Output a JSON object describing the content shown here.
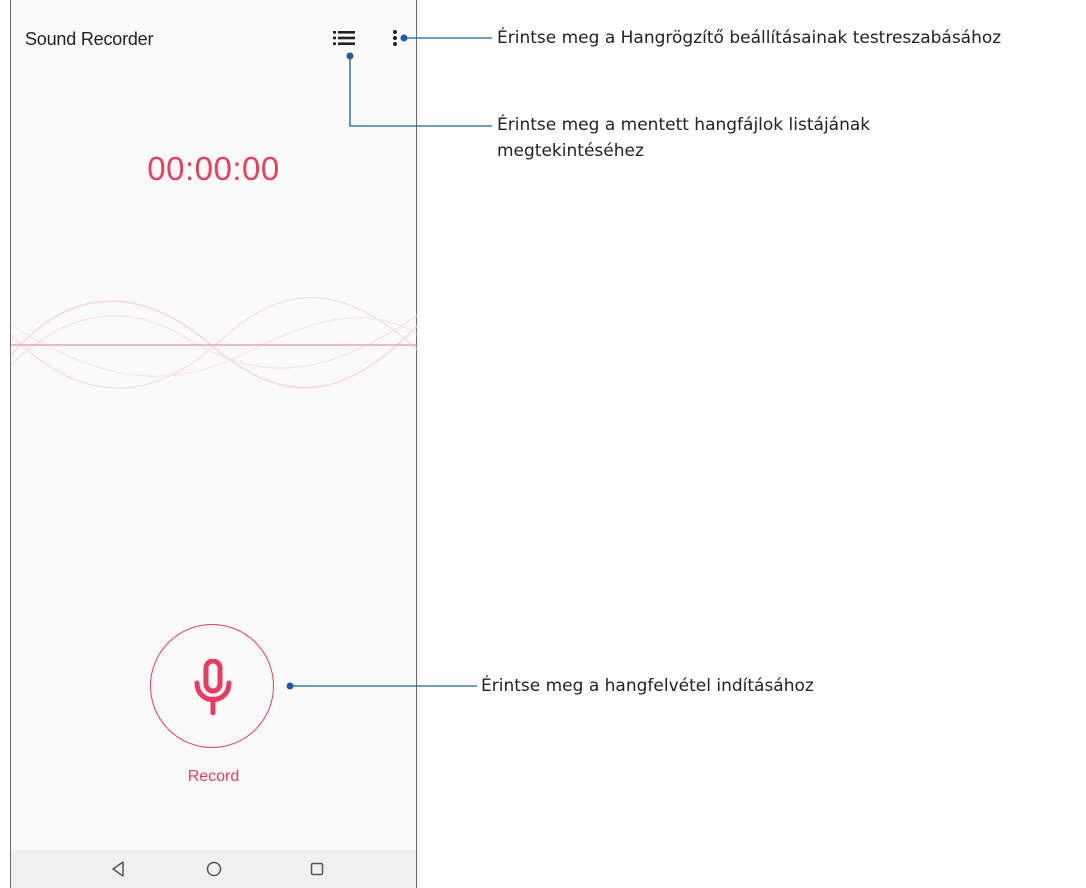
{
  "app": {
    "title": "Sound Recorder",
    "timer": "00:00:00",
    "record_label": "Record",
    "accent_color": "#e83e5f"
  },
  "icons": {
    "list": "list-icon",
    "more": "more-vert-icon",
    "mic": "microphone-icon",
    "nav_back": "back-triangle-icon",
    "nav_home": "home-circle-icon",
    "nav_recent": "recent-square-icon"
  },
  "callouts": {
    "settings": "Érintse meg a Hangrögzítő beállításainak testreszabásához",
    "list": "Érintse meg a mentett hangfájlok listájának megtekintéséhez",
    "record": "Érintse meg a hangfelvétel indításához",
    "line_color": "#1a5ea8"
  }
}
